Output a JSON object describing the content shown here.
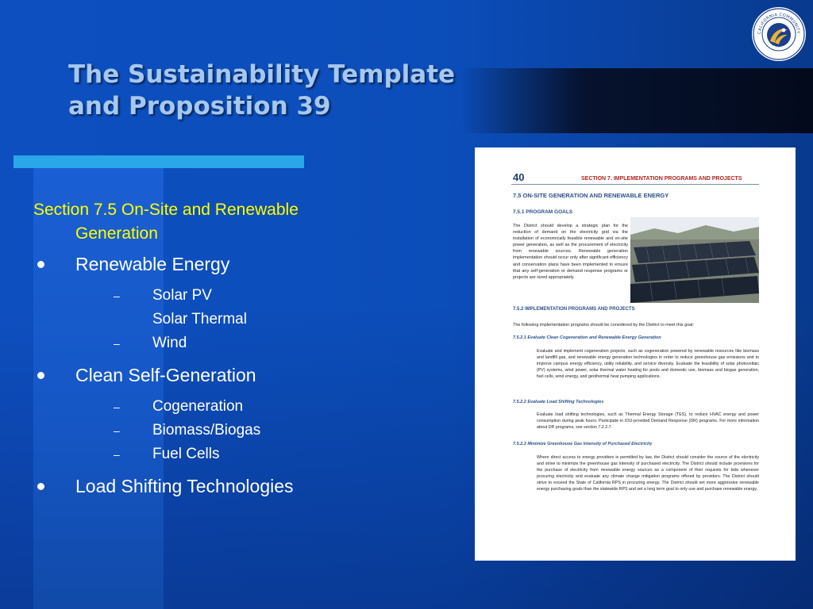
{
  "title": {
    "line1": "The Sustainability Template",
    "line2": "and Proposition 39"
  },
  "logo": {
    "icon": "california-community-colleges-seal-icon",
    "text": "CALIFORNIA COMMUNITY COLLEGES"
  },
  "section_heading": {
    "line1": "Section 7.5  On-Site and Renewable",
    "line2": "Generation"
  },
  "bullets": [
    {
      "label": "Renewable Energy",
      "subs": [
        "Solar PV",
        "Solar Thermal",
        "Wind"
      ],
      "dashes": [
        true,
        false,
        true
      ]
    },
    {
      "label": "Clean Self-Generation",
      "subs": [
        "Cogeneration",
        "Biomass/Biogas",
        "Fuel Cells"
      ],
      "dashes": [
        true,
        true,
        true
      ]
    },
    {
      "label": "Load Shifting Technologies",
      "subs": [],
      "dashes": []
    }
  ],
  "document": {
    "page_number": "40",
    "header": "SECTION 7. IMPLEMENTATION PROGRAMS AND PROJECTS",
    "heading_75": "7.5     ON-SITE GENERATION AND RENEWABLE ENERGY",
    "heading_751": "7.5.1    PROGRAM GOALS",
    "goals_text": "The District should develop a strategic plan for the reduction of demand on the electricity grid via the installation of economically feasible renewable and on-site power generation, as well as the procurement of electricity from renewable sources. Renewable generation implementation should occur only after significant efficiency and conservation plans have been implemented to ensure that any self-generation or demand response programs or projects are sized appropriately.",
    "heading_752": "7.5.2    IMPLEMENTATION PROGRAMS AND PROJECTS",
    "intro": "The following implementation programs should be considered by the District to meet this goal:",
    "subsections": [
      {
        "heading": "7.5.2.1      Evaluate Clean Cogeneration and Renewable Energy Generation",
        "text": "Evaluate and implement cogeneration projects, such as cogeneration powered by renewable resources like biomass and landfill gas, and renewable energy generation technologies in order to reduce greenhouse gas emissions and to improve campus energy efficiency, utility reliability, and service diversity.  Evaluate the feasibility of solar photovoltaic (PV) systems, wind power, solar thermal water heating for pools and domestic use, biomass and biogas generation, fuel cells, wind energy, and geothermal heat pumping applications."
      },
      {
        "heading": "7.5.2.2      Evaluate Load Shifting Technologies",
        "text": "Evaluate load shifting technologies, such as Thermal Energy Storage (TES), to reduce HVAC energy and power consumption during peak hours. Participate in IOU-provided Demand Response (DR) programs.  For more information about DR programs, see section 7.2.2.7."
      },
      {
        "heading": "7.5.2.3      Minimize Greenhouse Gas Intensity of Purchased Electricity",
        "text": "Where direct access to energy providers is permitted by law, the District should consider the source of the electricity and strive to minimize the greenhouse gas intensity of purchased electricity.  The District should include provisions for the purchase of electricity from renewable energy sources as a component of their requests for bids whenever procuring electricity and evaluate any climate change mitigation programs offered by providers.  The District should strive to exceed the State of California RPS in procuring energy. The District should set more aggressive renewable energy purchasing goals than the statewide RPS and set a long term goal to only use and purchase renewable energy."
      }
    ]
  }
}
